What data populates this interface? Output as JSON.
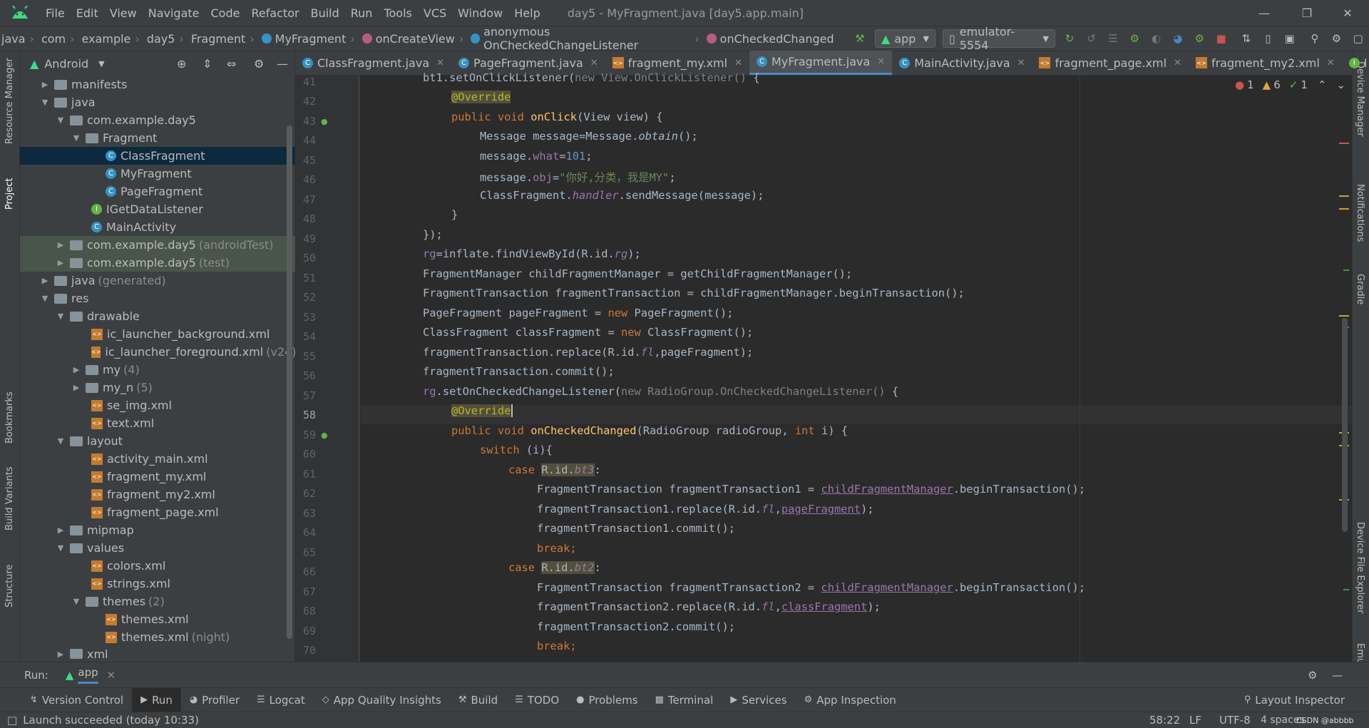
{
  "menu": {
    "items": [
      "File",
      "Edit",
      "View",
      "Navigate",
      "Code",
      "Refactor",
      "Build",
      "Run",
      "Tools",
      "VCS",
      "Window",
      "Help"
    ],
    "window_title": "day5 - MyFragment.java [day5.app.main]"
  },
  "breadcrumbs": [
    "java",
    "com",
    "example",
    "day5",
    "Fragment",
    "MyFragment",
    "onCreateView",
    "anonymous OnCheckedChangeListener",
    "onCheckedChanged"
  ],
  "run_config": "app",
  "device": "emulator-5554",
  "project_panel": {
    "view_mode": "Android",
    "tree": [
      {
        "label": "manifests",
        "extra": ""
      },
      {
        "label": "java",
        "extra": ""
      },
      {
        "label": "com.example.day5",
        "extra": ""
      },
      {
        "label": "Fragment",
        "extra": ""
      },
      {
        "label": "ClassFragment",
        "extra": ""
      },
      {
        "label": "MyFragment",
        "extra": ""
      },
      {
        "label": "PageFragment",
        "extra": ""
      },
      {
        "label": "IGetDataListener",
        "extra": ""
      },
      {
        "label": "MainActivity",
        "extra": ""
      },
      {
        "label": "com.example.day5",
        "extra": "(androidTest)"
      },
      {
        "label": "com.example.day5",
        "extra": "(test)"
      },
      {
        "label": "java",
        "extra": "(generated)"
      },
      {
        "label": "res",
        "extra": ""
      },
      {
        "label": "drawable",
        "extra": ""
      },
      {
        "label": "ic_launcher_background.xml",
        "extra": ""
      },
      {
        "label": "ic_launcher_foreground.xml",
        "extra": "(v24)"
      },
      {
        "label": "my",
        "extra": "(4)"
      },
      {
        "label": "my_n",
        "extra": "(5)"
      },
      {
        "label": "se_img.xml",
        "extra": ""
      },
      {
        "label": "text.xml",
        "extra": ""
      },
      {
        "label": "layout",
        "extra": ""
      },
      {
        "label": "activity_main.xml",
        "extra": ""
      },
      {
        "label": "fragment_my.xml",
        "extra": ""
      },
      {
        "label": "fragment_my2.xml",
        "extra": ""
      },
      {
        "label": "fragment_page.xml",
        "extra": ""
      },
      {
        "label": "mipmap",
        "extra": ""
      },
      {
        "label": "values",
        "extra": ""
      },
      {
        "label": "colors.xml",
        "extra": ""
      },
      {
        "label": "strings.xml",
        "extra": ""
      },
      {
        "label": "themes",
        "extra": "(2)"
      },
      {
        "label": "themes.xml",
        "extra": ""
      },
      {
        "label": "themes.xml",
        "extra": "(night)"
      },
      {
        "label": "xml",
        "extra": ""
      }
    ]
  },
  "tabs": [
    "ClassFragment.java",
    "PageFragment.java",
    "fragment_my.xml",
    "MyFragment.java",
    "MainActivity.java",
    "fragment_page.xml",
    "fragment_my2.xml",
    "I"
  ],
  "inspections": {
    "errors": "1",
    "warnings": "6",
    "weak": "1"
  },
  "line_numbers": [
    "41",
    "42",
    "43",
    "44",
    "45",
    "46",
    "47",
    "48",
    "49",
    "50",
    "51",
    "52",
    "53",
    "54",
    "55",
    "56",
    "57",
    "58",
    "59",
    "60",
    "61",
    "62",
    "63",
    "64",
    "65",
    "66",
    "67",
    "68",
    "69",
    "70"
  ],
  "left_stripe": [
    "Resource Manager",
    "Project",
    "Bookmarks",
    "Build Variants",
    "Structure"
  ],
  "right_stripe": [
    "Device Manager",
    "Notifications",
    "Gradle",
    "Device File Explorer",
    "Emulator"
  ],
  "run_bar": {
    "label": "Run:",
    "config": "app"
  },
  "tool_windows": [
    "Version Control",
    "Run",
    "Profiler",
    "Logcat",
    "App Quality Insights",
    "Build",
    "TODO",
    "Problems",
    "Terminal",
    "Services",
    "App Inspection"
  ],
  "layout_inspector": "Layout Inspector",
  "status": {
    "message": "Launch succeeded (today 10:33)",
    "position": "58:22",
    "line_sep": "LF",
    "encoding": "UTF-8",
    "indent": "4 spaces",
    "watermark": "CSDN @abbbb"
  }
}
